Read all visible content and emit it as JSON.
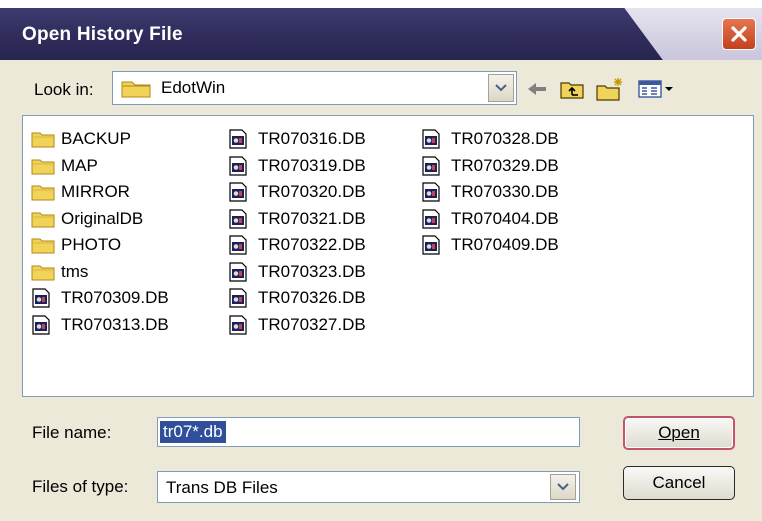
{
  "window": {
    "title": "Open History File"
  },
  "lookin": {
    "label": "Look in:",
    "value": "EdotWin"
  },
  "files": {
    "col1": [
      {
        "name": "BACKUP",
        "icon": "folder-icon"
      },
      {
        "name": "MAP",
        "icon": "folder-icon"
      },
      {
        "name": "MIRROR",
        "icon": "folder-icon"
      },
      {
        "name": "OriginalDB",
        "icon": "folder-icon"
      },
      {
        "name": "PHOTO",
        "icon": "folder-icon"
      },
      {
        "name": "tms",
        "icon": "folder-icon"
      },
      {
        "name": "TR070309.DB",
        "icon": "db-file-icon"
      },
      {
        "name": "TR070313.DB",
        "icon": "db-file-icon"
      }
    ],
    "col2": [
      {
        "name": "TR070316.DB",
        "icon": "db-file-icon"
      },
      {
        "name": "TR070319.DB",
        "icon": "db-file-icon"
      },
      {
        "name": "TR070320.DB",
        "icon": "db-file-icon"
      },
      {
        "name": "TR070321.DB",
        "icon": "db-file-icon"
      },
      {
        "name": "TR070322.DB",
        "icon": "db-file-icon"
      },
      {
        "name": "TR070323.DB",
        "icon": "db-file-icon"
      },
      {
        "name": "TR070326.DB",
        "icon": "db-file-icon"
      },
      {
        "name": "TR070327.DB",
        "icon": "db-file-icon"
      }
    ],
    "col3": [
      {
        "name": "TR070328.DB",
        "icon": "db-file-icon"
      },
      {
        "name": "TR070329.DB",
        "icon": "db-file-icon"
      },
      {
        "name": "TR070330.DB",
        "icon": "db-file-icon"
      },
      {
        "name": "TR070404.DB",
        "icon": "db-file-icon"
      },
      {
        "name": "TR070409.DB",
        "icon": "db-file-icon"
      }
    ]
  },
  "filename": {
    "label": "File name:",
    "value": "tr07*.db"
  },
  "filetype": {
    "label": "Files of type:",
    "value": "Trans DB Files"
  },
  "buttons": {
    "open": "Open",
    "cancel": "Cancel"
  },
  "colors": {
    "title_bar": "#2f2c5c",
    "selection": "#2f4f9b",
    "close_button": "#c2421e",
    "folder": "#f2d35a"
  }
}
